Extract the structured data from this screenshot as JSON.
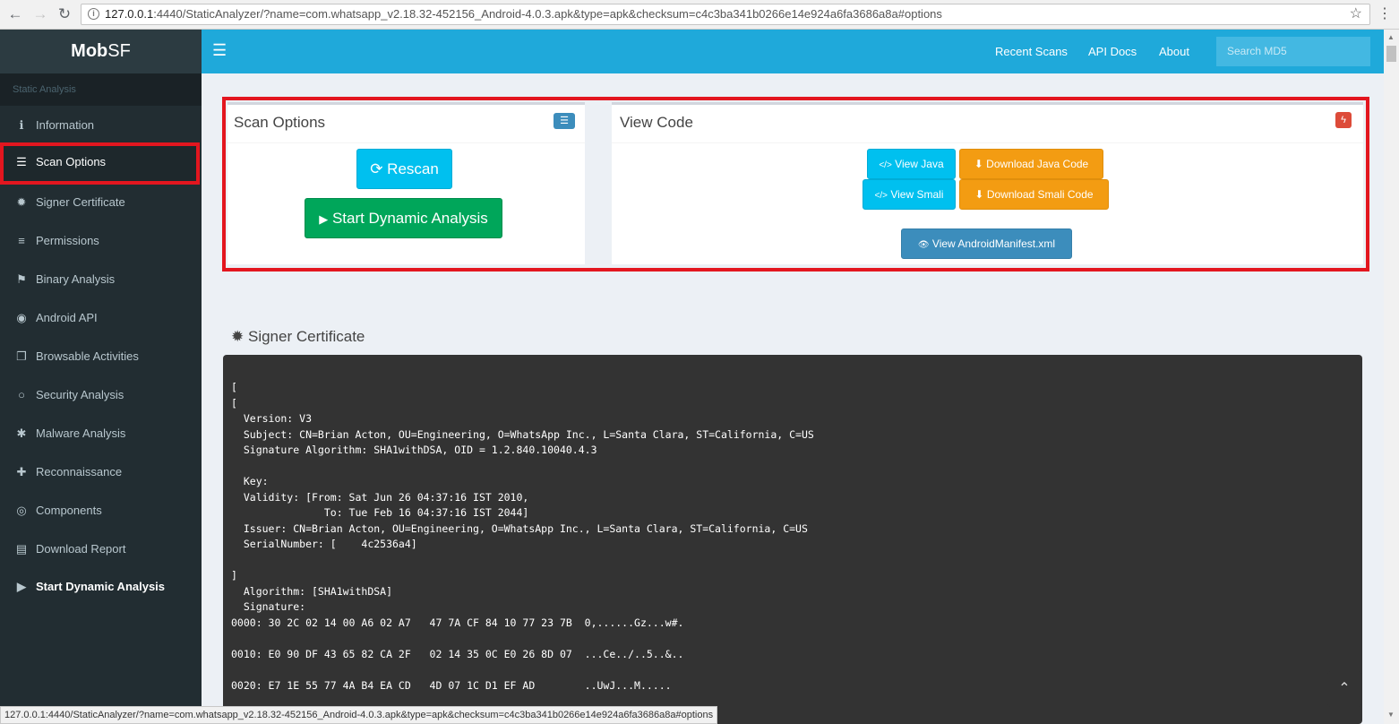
{
  "browser": {
    "url_host": "127.0.0.1",
    "url_rest": ":4440/StaticAnalyzer/?name=com.whatsapp_v2.18.32-452156_Android-4.0.3.apk&type=apk&checksum=c4c3ba341b0266e14e924a6fa3686a8a#options",
    "back": "←",
    "forward": "→",
    "reload": "↻",
    "info": "i",
    "star": "☆",
    "menu": "⋮"
  },
  "sidebar": {
    "brand_bold": "Mob",
    "brand_rest": "SF",
    "header": "Static Analysis",
    "items": [
      {
        "label": "Information",
        "icon": "ℹ"
      },
      {
        "label": "Scan Options",
        "icon": "☰"
      },
      {
        "label": "Signer Certificate",
        "icon": "✹"
      },
      {
        "label": "Permissions",
        "icon": "≡"
      },
      {
        "label": "Binary Analysis",
        "icon": "⚑"
      },
      {
        "label": "Android API",
        "icon": "◉"
      },
      {
        "label": "Browsable Activities",
        "icon": "❐"
      },
      {
        "label": "Security Analysis",
        "icon": "○"
      },
      {
        "label": "Malware Analysis",
        "icon": "✱"
      },
      {
        "label": "Reconnaissance",
        "icon": "✚"
      },
      {
        "label": "Components",
        "icon": "◎"
      },
      {
        "label": "Download Report",
        "icon": "▤"
      },
      {
        "label": "Start Dynamic Analysis",
        "icon": "▶"
      }
    ]
  },
  "topbar": {
    "menu_icon": "☰",
    "links": [
      "Recent Scans",
      "API Docs",
      "About"
    ],
    "search_placeholder": "Search MD5"
  },
  "scan_options": {
    "title": "Scan Options",
    "rescan": "Rescan",
    "rescan_icon": "⟳",
    "dynamic": "Start Dynamic Analysis",
    "dynamic_icon": "▶",
    "badge_icon": "☰"
  },
  "view_code": {
    "title": "View Code",
    "badge_icon": "ϟ",
    "view_java": "View Java",
    "download_java": "Download Java Code",
    "view_smali": "View Smali",
    "download_smali": "Download Smali Code",
    "view_manifest": "View AndroidManifest.xml",
    "code_icon": "</>",
    "download_icon": "⬇",
    "eye_icon": "👁"
  },
  "signer": {
    "title": "Signer Certificate",
    "icon": "✹",
    "lines": [
      "[",
      "[",
      "  Version: V3",
      "  Subject: CN=Brian Acton, OU=Engineering, O=WhatsApp Inc., L=Santa Clara, ST=California, C=US",
      "  Signature Algorithm: SHA1withDSA, OID = 1.2.840.10040.4.3",
      "",
      "  Key:",
      "  Validity: [From: Sat Jun 26 04:37:16 IST 2010,",
      "               To: Tue Feb 16 04:37:16 IST 2044]",
      "  Issuer: CN=Brian Acton, OU=Engineering, O=WhatsApp Inc., L=Santa Clara, ST=California, C=US",
      "  SerialNumber: [    4c2536a4]",
      "",
      "]",
      "  Algorithm: [SHA1withDSA]",
      "  Signature:",
      "0000: 30 2C 02 14 00 A6 02 A7   47 7A CF 84 10 77 23 7B  0,......Gz...w#.",
      "",
      "0010: E0 90 DF 43 65 82 CA 2F   02 14 35 0C E0 26 8D 07  ...Ce../..5..&..",
      "",
      "0020: E7 1E 55 77 4A B4 EA CD   4D 07 1C D1 EF AD        ..UwJ...M....."
    ]
  },
  "back_to_top": "⌃",
  "status_url": "127.0.0.1:4440/StaticAnalyzer/?name=com.whatsapp_v2.18.32-452156_Android-4.0.3.apk&type=apk&checksum=c4c3ba341b0266e14e924a6fa3686a8a#options"
}
